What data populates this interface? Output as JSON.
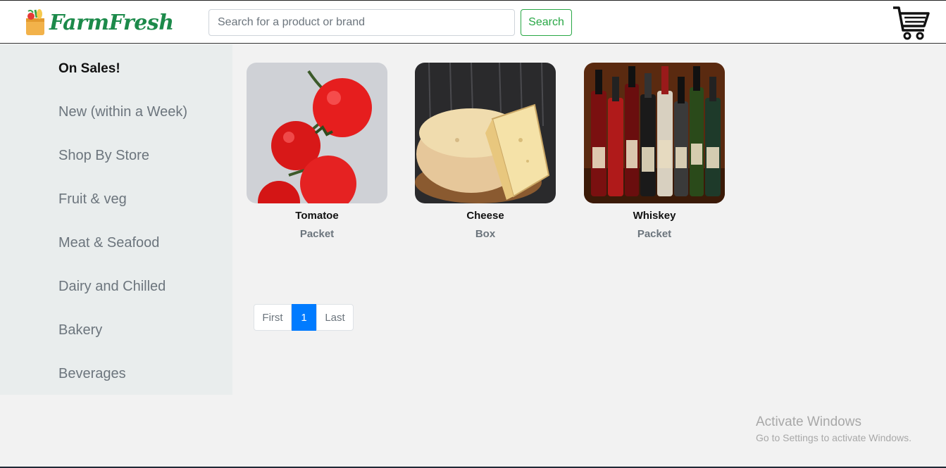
{
  "brand": {
    "name": "FarmFresh"
  },
  "search": {
    "placeholder": "Search for a product or brand",
    "button_label": "Search"
  },
  "sidebar": {
    "items": [
      {
        "label": "On Sales!",
        "active": true
      },
      {
        "label": "New (within a Week)"
      },
      {
        "label": "Shop By Store"
      },
      {
        "label": "Fruit & veg"
      },
      {
        "label": "Meat & Seafood"
      },
      {
        "label": "Dairy and Chilled"
      },
      {
        "label": "Bakery"
      },
      {
        "label": "Beverages"
      }
    ]
  },
  "products": [
    {
      "name": "Tomatoe",
      "unit": "Packet"
    },
    {
      "name": "Cheese",
      "unit": "Box"
    },
    {
      "name": "Whiskey",
      "unit": "Packet"
    }
  ],
  "pagination": {
    "first": "First",
    "current": "1",
    "last": "Last"
  },
  "watermark": {
    "title": "Activate Windows",
    "subtitle": "Go to Settings to activate Windows."
  },
  "colors": {
    "brand_green": "#1c8a4a",
    "search_green": "#28a745",
    "pagination_active": "#007bff",
    "sidebar_bg": "#e9eded"
  }
}
